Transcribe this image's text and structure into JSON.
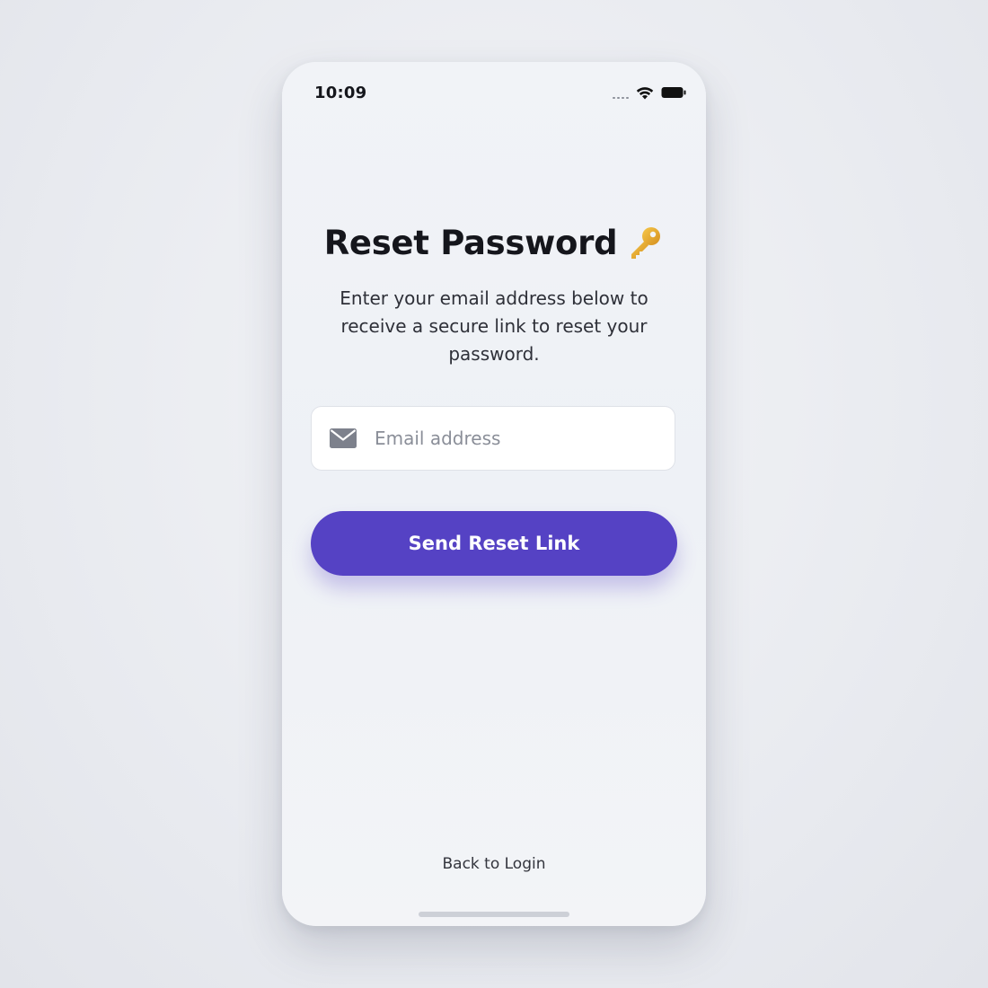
{
  "status_bar": {
    "time": "10:09",
    "icons": [
      "cellular-signal-icon",
      "wifi-icon",
      "battery-icon"
    ]
  },
  "header": {
    "title": "Reset Password",
    "title_icon": "key-icon",
    "subtitle": "Enter your email address below to receive a secure link to reset your password."
  },
  "form": {
    "email": {
      "icon": "mail-icon",
      "placeholder": "Email address",
      "value": ""
    },
    "submit_label": "Send Reset Link"
  },
  "footer": {
    "back_label": "Back to Login"
  },
  "colors": {
    "accent": "#5542c4",
    "text_primary": "#15161c",
    "text_secondary": "#2e3038",
    "placeholder": "#8a8e98",
    "key": "#e2a52c"
  }
}
